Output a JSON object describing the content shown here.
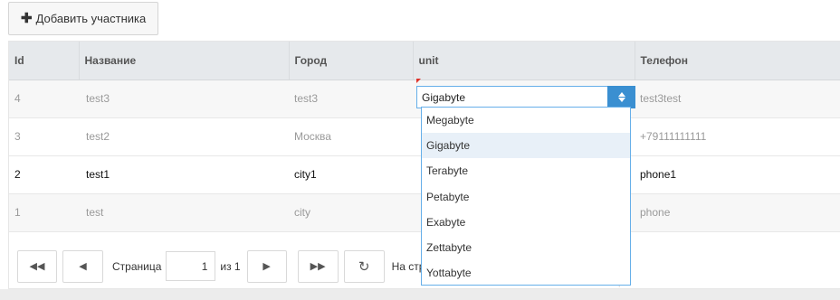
{
  "toolbar": {
    "add_button_label": "Добавить участника",
    "add_icon": "plus-icon"
  },
  "grid": {
    "columns": [
      "Id",
      "Название",
      "Город",
      "unit",
      "Телефон"
    ],
    "rows": [
      {
        "id": "4",
        "name": "test3",
        "city": "test3",
        "unit": "Gigabyte",
        "phone": "test3test"
      },
      {
        "id": "3",
        "name": "test2",
        "city": "Москва",
        "unit": "",
        "phone": "+79111111111"
      },
      {
        "id": "2",
        "name": "test1",
        "city": "city1",
        "unit": "",
        "phone": "phone1"
      },
      {
        "id": "1",
        "name": "test",
        "city": "city",
        "unit": "",
        "phone": "phone"
      }
    ]
  },
  "unit_select": {
    "value": "Gigabyte",
    "options": [
      "Megabyte",
      "Gigabyte",
      "Terabyte",
      "Petabyte",
      "Exabyte",
      "Zettabyte",
      "Yottabyte"
    ],
    "selected_index": 1
  },
  "pager": {
    "page_label": "Страница",
    "page_value": "1",
    "of_label": "из 1",
    "per_page_label": "На страниц",
    "icons": [
      "first-page-icon",
      "prev-page-icon",
      "next-page-icon",
      "last-page-icon",
      "refresh-icon"
    ]
  },
  "colors": {
    "accent": "#3a8fd1",
    "focus_border": "#66afe9",
    "header_bg": "#e6e9ec",
    "dirty_marker": "#e0312a"
  }
}
